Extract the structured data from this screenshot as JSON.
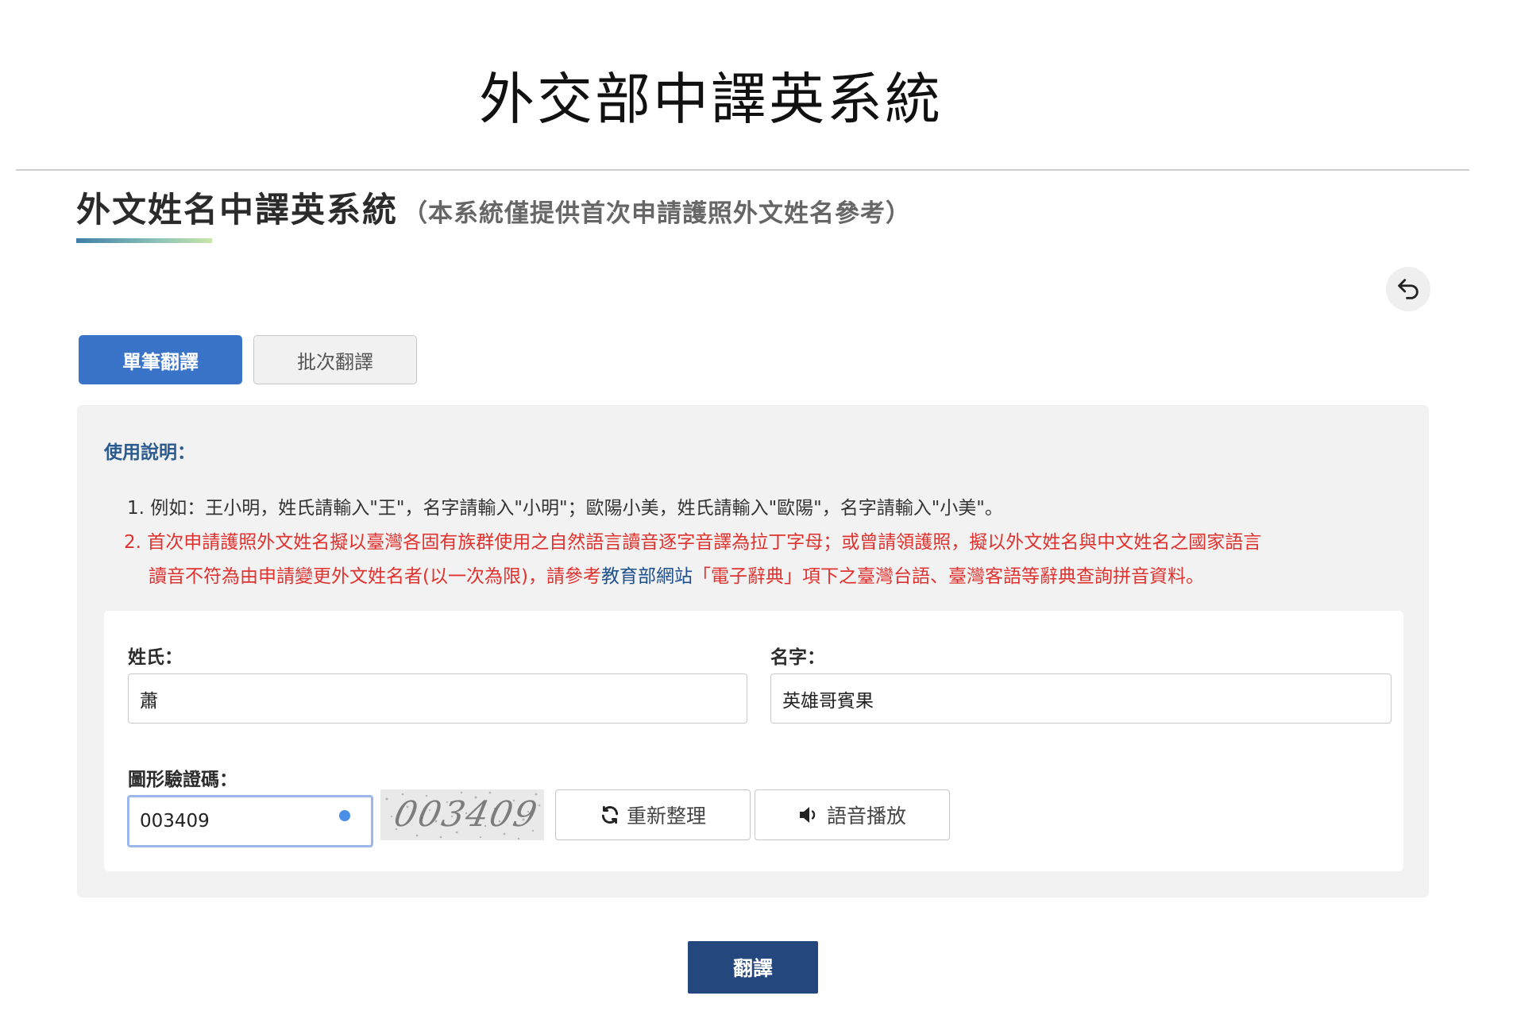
{
  "header": {
    "site_title": "外交部中譯英系統"
  },
  "section": {
    "title": "外文姓名中譯英系統",
    "subtitle": "（本系統僅提供首次申請護照外文姓名參考）"
  },
  "tabs": [
    {
      "label": "單筆翻譯",
      "active": true
    },
    {
      "label": "批次翻譯",
      "active": false
    }
  ],
  "instructions": {
    "title": "使用說明：",
    "item1": "1. 例如：王小明，姓氏請輸入\"王\"，名字請輸入\"小明\"；歐陽小美，姓氏請輸入\"歐陽\"，名字請輸入\"小美\"。",
    "item2_line1": "2. 首次申請護照外文姓名擬以臺灣各固有族群使用之自然語言讀音逐字音譯為拉丁字母；或曾請領護照，擬以外文姓名與中文姓名之國家語言",
    "item2_line2_prefix": "讀音不符為由申請變更外文姓名者(以一次為限)，請參考",
    "item2_link": "教育部網站",
    "item2_line2_suffix": "「電子辭典」項下之臺灣台語、臺灣客語等辭典查詢拼音資料。"
  },
  "form": {
    "surname_label": "姓氏：",
    "surname_value": "蕭",
    "given_name_label": "名字：",
    "given_name_value": "英雄哥賓果",
    "captcha_label": "圖形驗證碼：",
    "captcha_value": "003409",
    "captcha_image_text": "003409",
    "refresh_label": "重新整理",
    "audio_label": "語音播放"
  },
  "submit_label": "翻譯",
  "colors": {
    "primary_blue": "#3a74c8",
    "submit_navy": "#24477e",
    "warning_red": "#e0322f",
    "link_blue": "#1f4f8c",
    "panel_gray": "#f2f2f2"
  },
  "icons": {
    "back": "undo-arrow-icon",
    "refresh": "refresh-icon",
    "audio": "speaker-icon"
  }
}
